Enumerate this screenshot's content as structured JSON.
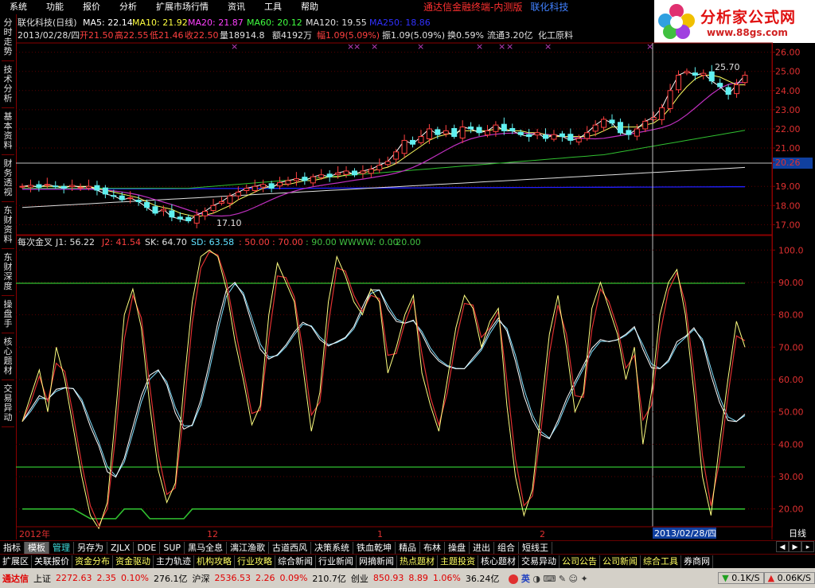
{
  "menubar": {
    "items": [
      "系统",
      "功能",
      "报价",
      "分析",
      "扩展市场行情",
      "资讯",
      "工具",
      "帮助"
    ],
    "brand_main": "通达信金融终端-内测版",
    "brand_sub": "联化科技"
  },
  "logo": {
    "title": "分析家公式网",
    "url_text": "www.88gs.com"
  },
  "sidebar": {
    "tabs": [
      "分时走势",
      "技术分析",
      "基本资料",
      "财务透视",
      "东财资料",
      "东财深度",
      "操盘手",
      "核心题材",
      "交易异动"
    ]
  },
  "price_panel": {
    "ma_line": {
      "stock": "联化科技(日线)",
      "ma5": "MA5: 22.14",
      "ma10": "MA10: 21.92",
      "ma20": "MA20: 21.87",
      "ma60": "MA60: 20.12",
      "ma120": "MA120: 19.55",
      "ma250": "MA250: 18.86"
    },
    "info_line": {
      "date": "2013/02/28/四",
      "open": "开21.50",
      "high": "高22.55",
      "low": "低21.46",
      "close": "收22.50",
      "vol": "量18914.8",
      "amount": "额4192万",
      "change": "幅1.09(5.09%)",
      "amp": "振1.09(5.09%)",
      "turnover": "换0.59%",
      "float": "流通3.20亿",
      "sector": "化工原料"
    },
    "price_ticks": [
      "26.00",
      "25.00",
      "24.00",
      "23.00",
      "22.00",
      "21.00",
      "20.26",
      "19.00",
      "18.00",
      "17.00"
    ],
    "high_label": "25.70",
    "low_label": "17.10"
  },
  "indicator_panel": {
    "name": "每次金叉",
    "j1": "J1: 56.22",
    "j2": "J2: 41.54",
    "sk": "SK: 64.70",
    "sd": "SD: 63.58",
    "c50": ": 50.00",
    "c70": ": 70.00",
    "c90": ": 90.00",
    "wwww": "WWWW: 0.00",
    "c20": ": 20.00",
    "ticks": [
      "100.0",
      "90.00",
      "80.00",
      "70.00",
      "60.00",
      "50.00",
      "40.00",
      "30.00",
      "20.00"
    ]
  },
  "time_axis": {
    "labels": [
      "2012年",
      "12",
      "1",
      "2"
    ],
    "cursor_date": "2013/02/28/四",
    "period": "日线"
  },
  "toolbar1": {
    "items": [
      "指标",
      "模板",
      "管理",
      "另存为",
      "ZJLX",
      "DDE",
      "SUP",
      "黑马全息",
      "漓江渔歌",
      "古道西风",
      "决策系统",
      "铁血乾坤",
      "精品",
      "布林",
      "操盘",
      "进出",
      "组合",
      "短线王"
    ]
  },
  "toolbar2": {
    "items": [
      "扩展区",
      "关联报价",
      "资金分布",
      "资金驱动",
      "主力轨迹",
      "机构攻略",
      "行业攻略",
      "综合新闻",
      "行业新闻",
      "网摘新闻",
      "热点题材",
      "主题投资",
      "核心题材",
      "交易异动",
      "公司公告",
      "公司新闻",
      "综合工具",
      "券商网"
    ]
  },
  "statusbar": {
    "app": "通达信",
    "sh_label": "上证",
    "sh_val": "2272.63",
    "sh_chg": "2.35",
    "sh_pct": "0.10%",
    "sh_amt": "276.1亿",
    "sz_label": "沪深",
    "sz_val": "2536.53",
    "sz_chg": "2.26",
    "sz_pct": "0.09%",
    "sz_amt": "210.7亿",
    "cy_label": "创业",
    "cy_val": "850.93",
    "cy_chg": "8.89",
    "cy_pct": "1.06%",
    "cy_amt": "36.24亿",
    "ime": "英",
    "down_speed": "0.1K/S",
    "up_speed": "0.06K/S"
  },
  "chart_data": {
    "type": "candlestick",
    "price_ylim": [
      16.6,
      26.4
    ],
    "indicator_ylim": [
      15,
      104
    ],
    "closes": [
      19.0,
      19.05,
      18.95,
      19.1,
      19.0,
      18.9,
      19.05,
      18.95,
      19.0,
      18.8,
      18.6,
      18.5,
      18.3,
      18.4,
      18.2,
      17.9,
      17.6,
      17.8,
      17.4,
      17.3,
      17.2,
      17.5,
      17.7,
      18.0,
      18.2,
      18.5,
      18.7,
      18.9,
      19.0,
      19.1,
      18.9,
      19.2,
      19.3,
      19.4,
      19.3,
      19.5,
      19.6,
      19.5,
      19.7,
      19.8,
      19.6,
      19.8,
      19.9,
      20.1,
      20.3,
      20.8,
      21.4,
      21.2,
      21.6,
      22.0,
      21.7,
      21.9,
      21.6,
      22.1,
      22.0,
      21.8,
      21.9,
      22.2,
      21.9,
      21.9,
      21.7,
      21.6,
      21.8,
      21.5,
      21.7,
      21.6,
      21.4,
      21.5,
      21.8,
      22.2,
      22.5,
      22.3,
      21.8,
      21.7,
      22.0,
      22.4,
      22.6,
      23.1,
      24.0,
      24.8,
      25.0,
      24.8,
      24.9,
      24.5,
      24.2,
      23.8,
      24.3,
      24.8
    ],
    "ma5": [
      19.0,
      19.0,
      19.0,
      19.0,
      19.0,
      19.0,
      19.0,
      19.0,
      19.0,
      18.9,
      18.8,
      18.7,
      18.6,
      18.5,
      18.4,
      18.2,
      18.0,
      17.9,
      17.8,
      17.6,
      17.5,
      17.4,
      17.5,
      17.6,
      17.8,
      18.0,
      18.3,
      18.5,
      18.7,
      18.9,
      19.0,
      19.1,
      19.1,
      19.2,
      19.3,
      19.3,
      19.4,
      19.5,
      19.5,
      19.6,
      19.7,
      19.7,
      19.8,
      19.9,
      20.0,
      20.2,
      20.5,
      20.8,
      21.1,
      21.4,
      21.6,
      21.7,
      21.8,
      21.9,
      21.9,
      21.9,
      21.9,
      22.0,
      22.0,
      21.9,
      21.9,
      21.8,
      21.8,
      21.7,
      21.6,
      21.6,
      21.6,
      21.6,
      21.6,
      21.7,
      21.9,
      22.1,
      22.1,
      22.1,
      22.1,
      22.2,
      22.3,
      22.6,
      23.1,
      23.7,
      24.2,
      24.6,
      24.8,
      24.8,
      24.7,
      24.5,
      24.3,
      24.3
    ],
    "j1": [
      47,
      55,
      63,
      50,
      70,
      60,
      45,
      30,
      18,
      14,
      22,
      50,
      80,
      88,
      76,
      52,
      32,
      22,
      28,
      58,
      84,
      98,
      100,
      98,
      88,
      72,
      60,
      46,
      52,
      80,
      96,
      90,
      84,
      64,
      44,
      56,
      84,
      98,
      92,
      84,
      80,
      88,
      84,
      62,
      70,
      80,
      86,
      62,
      52,
      44,
      60,
      76,
      86,
      82,
      70,
      78,
      82,
      52,
      30,
      18,
      26,
      50,
      74,
      86,
      70,
      50,
      56,
      82,
      90,
      82,
      74,
      60,
      70,
      40,
      56,
      80,
      90,
      94,
      80,
      56,
      30,
      18,
      40,
      60,
      78,
      70
    ]
  }
}
